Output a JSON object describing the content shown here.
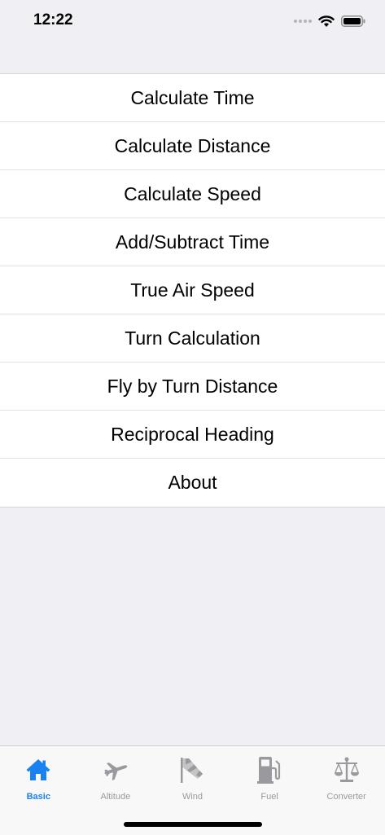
{
  "status_bar": {
    "time": "12:22"
  },
  "menu": {
    "items": [
      "Calculate Time",
      "Calculate Distance",
      "Calculate Speed",
      "Add/Subtract Time",
      "True Air Speed",
      "Turn Calculation",
      "Fly by Turn Distance",
      "Reciprocal Heading",
      "About"
    ]
  },
  "tab_bar": {
    "tabs": [
      {
        "label": "Basic",
        "icon": "house-icon",
        "active": true
      },
      {
        "label": "Altitude",
        "icon": "airplane-icon",
        "active": false
      },
      {
        "label": "Wind",
        "icon": "windsock-icon",
        "active": false
      },
      {
        "label": "Fuel",
        "icon": "fuel-pump-icon",
        "active": false
      },
      {
        "label": "Converter",
        "icon": "scale-icon",
        "active": false
      }
    ]
  },
  "colors": {
    "accent": "#1a82f0",
    "inactive": "#9a9a9e",
    "background": "#efeff4"
  }
}
